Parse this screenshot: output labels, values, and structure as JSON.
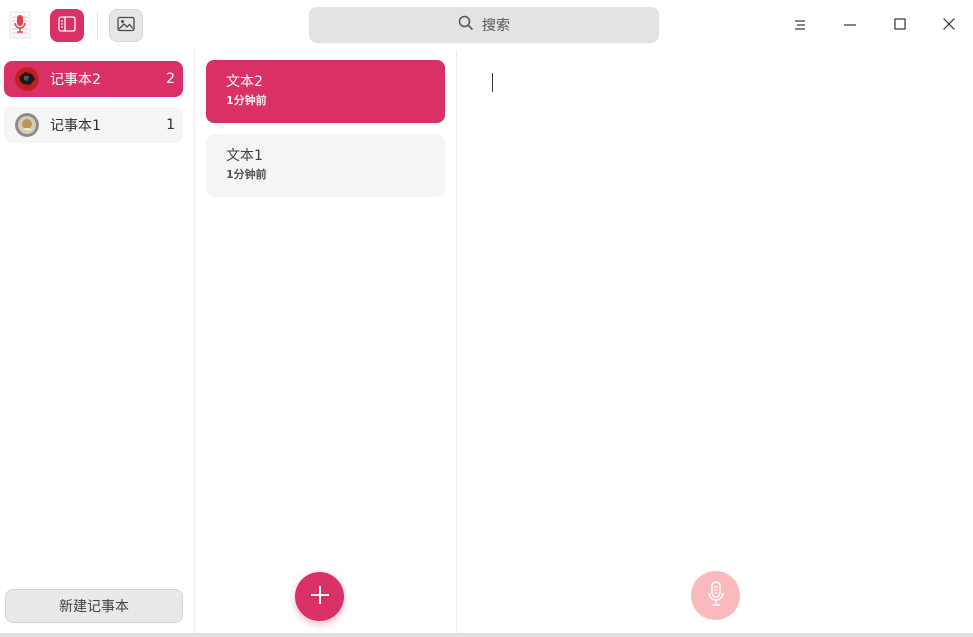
{
  "search": {
    "placeholder": "搜索"
  },
  "notebooks": {
    "items": [
      {
        "label": "记事本2",
        "count": "2",
        "active": true
      },
      {
        "label": "记事本1",
        "count": "1",
        "active": false
      }
    ],
    "new_button": "新建记事本"
  },
  "notes": {
    "items": [
      {
        "title": "文本2",
        "time": "1分钟前",
        "active": true
      },
      {
        "title": "文本1",
        "time": "1分钟前",
        "active": false
      }
    ]
  },
  "icons": {
    "app": "voice-note-app-icon",
    "sidebar_toggle": "sidebar-toggle-icon",
    "image": "image-icon",
    "search": "search-icon",
    "menu": "menu-icon",
    "minimize": "minimize-icon",
    "maximize": "maximize-icon",
    "close": "close-icon",
    "add": "plus-icon",
    "voice": "microphone-icon"
  },
  "colors": {
    "accent": "#d93166",
    "voice_button": "#f9b9bd",
    "panel_item": "#f5f5f5"
  }
}
